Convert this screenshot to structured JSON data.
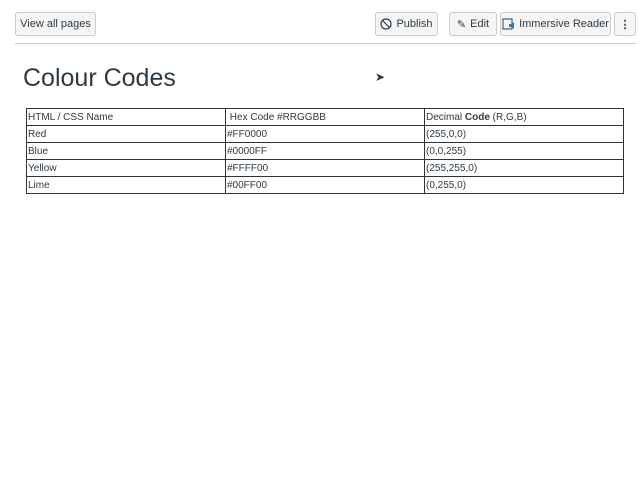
{
  "toolbar": {
    "view_all": "View all pages",
    "publish": "Publish",
    "edit": "Edit",
    "immersive": "Immersive Reader",
    "more": "⋮"
  },
  "page": {
    "title": "Colour Codes"
  },
  "table": {
    "headers": [
      "HTML / CSS Name",
      "Hex Code #RRGGBB",
      "Decimal ",
      "Code",
      " (R,G,B)"
    ],
    "rows": [
      [
        "Red",
        "#FF0000",
        "(255,0,0)"
      ],
      [
        "Blue",
        "#0000FF",
        "(0,0,255)"
      ],
      [
        "Yellow",
        "#FFFF00",
        "(255,255,0)"
      ],
      [
        "Lime",
        "#00FF00",
        "(0,255,0)"
      ]
    ]
  }
}
